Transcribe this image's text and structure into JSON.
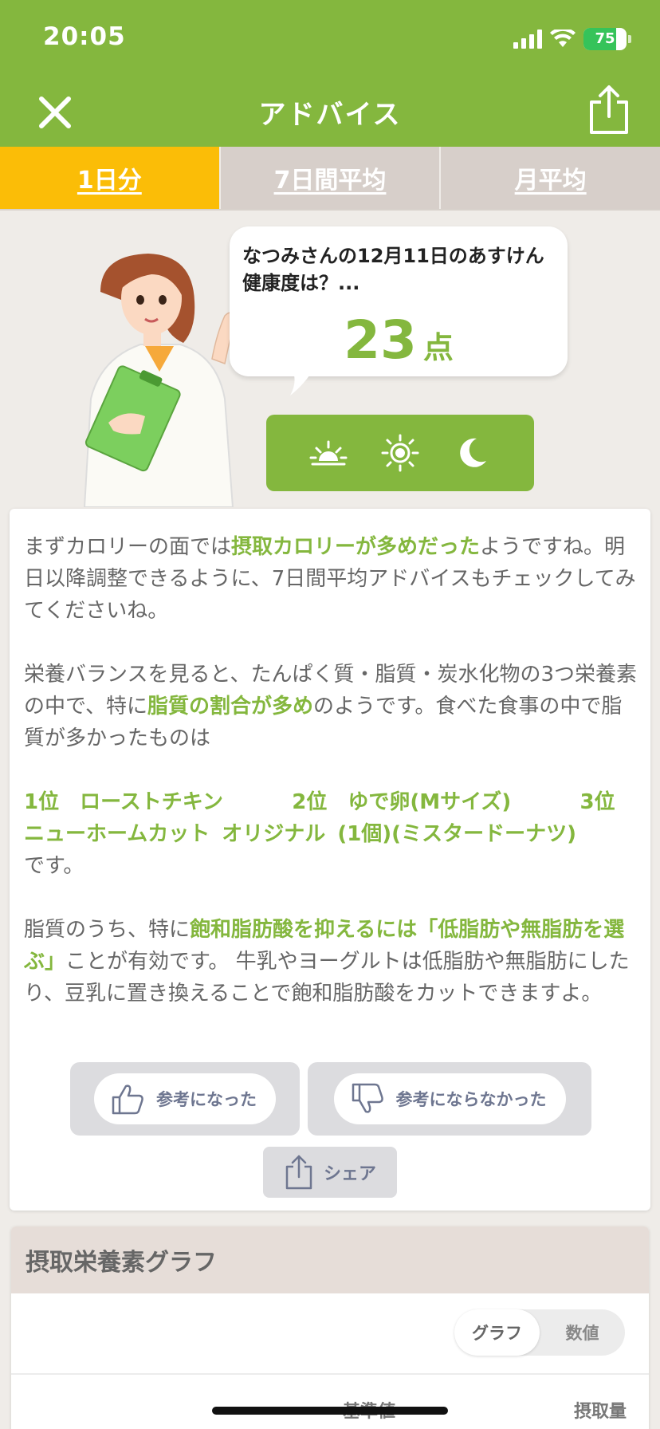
{
  "status": {
    "time": "20:05",
    "battery": "75"
  },
  "nav": {
    "title": "アドバイス"
  },
  "tabs": [
    {
      "label": "1日分",
      "active": true
    },
    {
      "label": "7日間平均",
      "active": false
    },
    {
      "label": "月平均",
      "active": false
    }
  ],
  "speech": {
    "text": "なつみさんの12月11日のあすけん健康度は？...",
    "score": "23",
    "unit": "点"
  },
  "meals": [
    "sunrise-icon",
    "sun-icon",
    "moon-icon"
  ],
  "advice": {
    "p1_a": "まずカロリーの面では",
    "p1_hl": "摂取カロリーが多めだった",
    "p1_b": "ようですね。明日以降調整できるように、7日間平均アドバイスもチェックしてみてくださいね。",
    "p2_a": "栄養バランスを見ると、たんぱく質・脂質・炭水化物の3つ栄養素の中で、特に",
    "p2_hl": "脂質の割合が多め",
    "p2_b": "のようです。食べた食事の中で脂質が多かったものは",
    "rank1": "1位　ローストチキン",
    "rank2": "2位　ゆで卵(Mサイズ)",
    "rank3": "3位　ニューホームカット オリジナル (1個)(ミスタードーナツ)",
    "p3_end": "です。",
    "p4_a": "脂質のうち、特に",
    "p4_hl": "飽和脂肪酸を抑えるには「低脂肪や無脂肪を選ぶ」",
    "p4_b": "ことが有効です。 牛乳やヨーグルトは低脂肪や無脂肪にしたり、豆乳に置き換えることで飽和脂肪酸をカットできますよ。"
  },
  "feedback": {
    "good": "参考になった",
    "bad": "参考にならなかった",
    "share": "シェア"
  },
  "graph": {
    "title": "摂取栄養素グラフ",
    "toggle": [
      "グラフ",
      "数値"
    ],
    "selected": "グラフ",
    "col_standard": "基準値",
    "col_intake": "摂取量"
  },
  "colors": {
    "brand_green": "#84b73e",
    "tab_active": "#fbbd07",
    "tab_inactive": "#d7cfca"
  }
}
